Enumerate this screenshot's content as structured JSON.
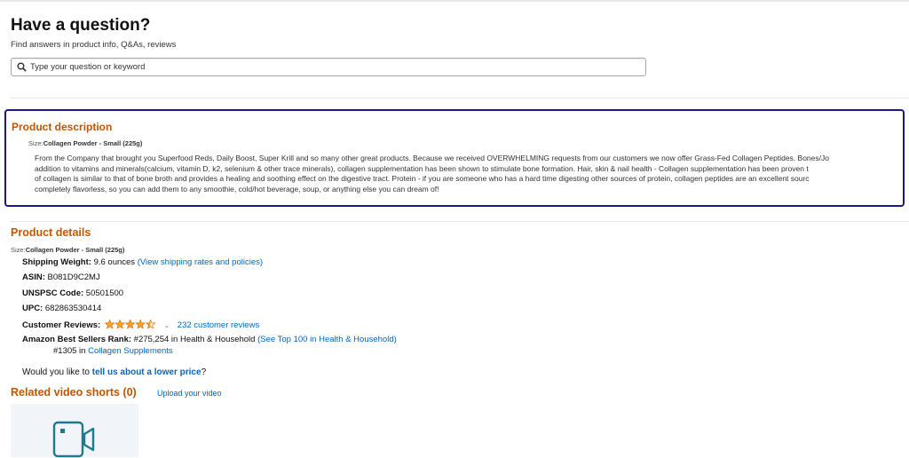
{
  "question": {
    "title": "Have a question?",
    "subtitle": "Find answers in product info, Q&As, reviews",
    "placeholder": "Type your question or keyword",
    "icon": "search-icon"
  },
  "description": {
    "title": "Product description",
    "size_label": "Size:",
    "size_value": "Collagen Powder - Small (225g)",
    "lines": [
      "From the Company that brought you Superfood Reds, Daily Boost, Super Krill and so many other great products. Because we received OVERWHELMING requests from our customers we now offer Grass-Fed Collagen Peptides. Bones/Jo",
      "addition to vitamins and minerals(calcium, vitamin D, k2, selenium & other trace minerals), collagen supplementation has been shown to stimulate bone formation. Hair, skin & nail health - Collagen supplementation has been proven t",
      "of collagen is similar to that of bone broth and provides a healing and soothing effect on the digestive tract. Protein - if you are someone who has a hard time digesting other sources of protein, collagen peptides are an excellent sourc",
      "completely flavorless, so you can add them to any smoothie, cold/hot beverage, soup, or anything else you can dream of!"
    ],
    "highlight_color": "#1e178c"
  },
  "details": {
    "title": "Product details",
    "size_label": "Size:",
    "size_value": "Collagen Powder - Small (225g)",
    "shipping_label": "Shipping Weight:",
    "shipping_value": "9.6 ounces",
    "shipping_link": "(View shipping rates and policies)",
    "asin_label": "ASIN:",
    "asin_value": "B081D9C2MJ",
    "unspsc_label": "UNSPSC Code:",
    "unspsc_value": "50501500",
    "upc_label": "UPC:",
    "upc_value": "682863530414",
    "reviews_label": "Customer Reviews:",
    "rating": 4.5,
    "reviews_link": "232 customer reviews",
    "rank_label": "Amazon Best Sellers Rank:",
    "rank_value": "#275,254 in Health & Household",
    "rank_link": "(See Top 100 in Health & Household)",
    "rank2_value": "#1305 in",
    "rank2_link": "Collagen Supplements"
  },
  "lower_price": {
    "prefix": "Would you like to",
    "link": "tell us about a lower price",
    "suffix": "?"
  },
  "related_videos": {
    "title": "Related video shorts (0)",
    "upload_link": "Upload your video",
    "icon": "video-camera-icon"
  },
  "colors": {
    "section_title": "#c45500",
    "link": "#0066c0",
    "star": "#ffa41c"
  }
}
